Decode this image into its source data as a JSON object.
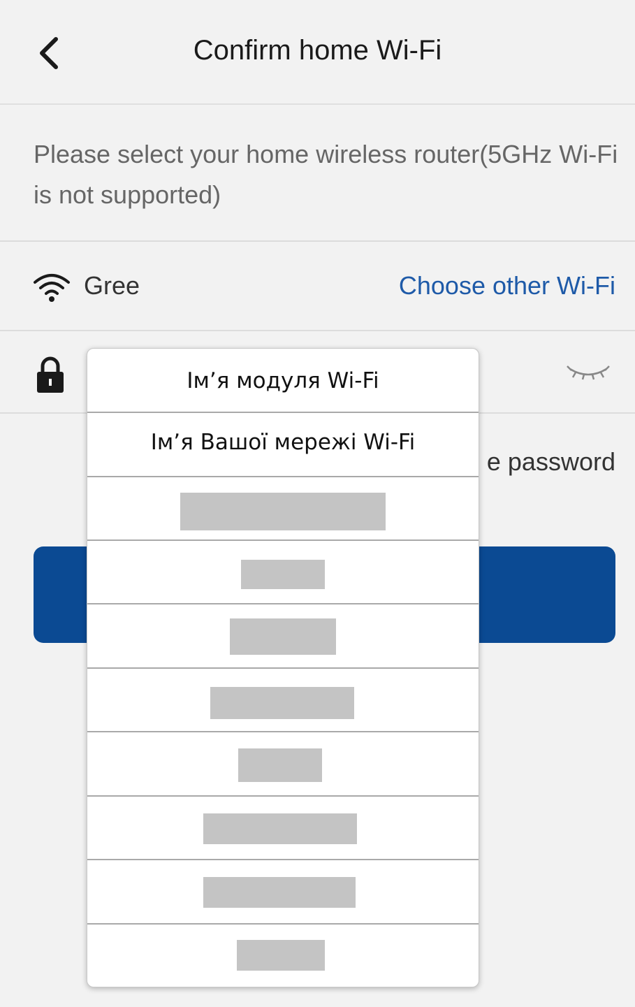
{
  "header": {
    "back_icon": "chevron-left-icon",
    "title": "Confirm home Wi-Fi"
  },
  "instruction": "Please select your home wireless router(5GHz Wi-Fi is not supported)",
  "wifi_row": {
    "icon": "wifi-icon",
    "network_name": "Gree",
    "choose_link": "Choose other Wi-Fi"
  },
  "password_row": {
    "lock_icon": "lock-icon",
    "eye_icon": "eye-closed-icon",
    "remember_text_visible": "e password"
  },
  "popup": {
    "labels": [
      "Ім’я модуля Wi-Fi",
      "Ім’я Вашої мережі Wi-Fi"
    ],
    "redacted_rows": 8
  },
  "colors": {
    "background": "#f2f2f2",
    "link": "#1e5aa8",
    "button": "#0b4a93",
    "redaction": "#c4c4c4"
  }
}
